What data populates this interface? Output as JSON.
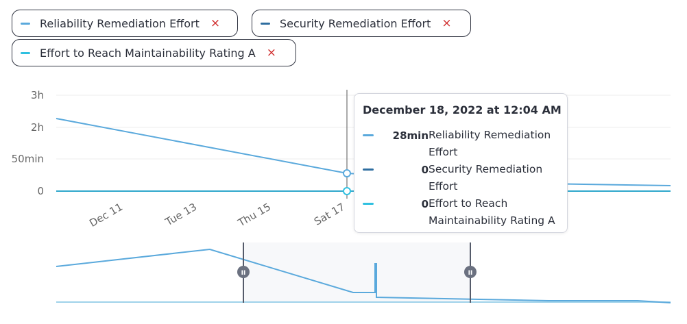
{
  "colors": {
    "reliability": "#5aa9dc",
    "security": "#2f6ea0",
    "maintainability": "#2fc0e0",
    "remove": "#d02b2b",
    "brush_handle": "#6b7180"
  },
  "filters": [
    {
      "label": "Reliability Remediation Effort",
      "remove_icon": "×"
    },
    {
      "label": "Security Remediation Effort",
      "remove_icon": "×"
    },
    {
      "label": "Effort to Reach Maintainability Rating A",
      "remove_icon": "×"
    }
  ],
  "chart_data": {
    "type": "line",
    "y_ticks": [
      "3h",
      "2h",
      "50min",
      "0"
    ],
    "x_ticks": [
      "Dec 11",
      "Tue 13",
      "Thu 15",
      "Sat 17"
    ],
    "series": [
      {
        "name": "Reliability Remediation Effort",
        "x": [
          "Dec 9",
          "Dec 18"
        ],
        "y_minutes": [
          130,
          28
        ]
      },
      {
        "name": "Security Remediation Effort",
        "x": [
          "Dec 9",
          "Dec 18"
        ],
        "y_minutes": [
          0,
          0
        ]
      },
      {
        "name": "Effort to Reach Maintainability Rating A",
        "x": [
          "Dec 9",
          "Dec 18"
        ],
        "y_minutes": [
          0,
          0
        ]
      }
    ],
    "grid": true
  },
  "tooltip": {
    "title": "December 18, 2022 at 12:04 AM",
    "rows": [
      {
        "value": "28min",
        "name": "Reliability Remediation Effort"
      },
      {
        "value": "0",
        "name": "Security Remediation Effort"
      },
      {
        "value": "0",
        "name": "Effort to Reach Maintainability Rating A"
      }
    ]
  },
  "brush": {
    "handle_icon": "II"
  }
}
